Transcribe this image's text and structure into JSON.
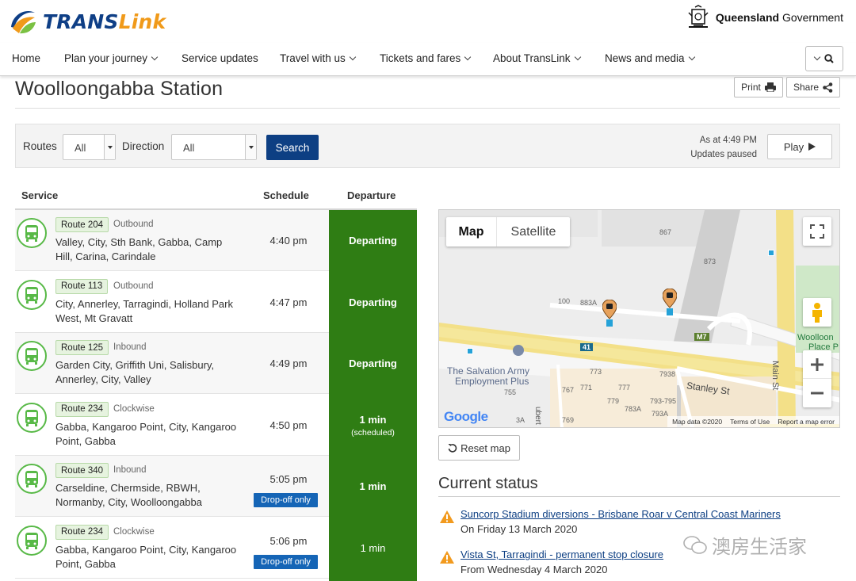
{
  "brand": {
    "name_a": "TRANS",
    "name_b": "Link",
    "gov": "Queensland",
    "gov_b": "Government",
    "blue": "#0f3f86",
    "orange": "#f09a1a"
  },
  "nav": [
    "Home",
    "Plan your journey",
    "Service updates",
    "Travel with us",
    "Tickets and fares",
    "About TransLink",
    "News and media"
  ],
  "page": {
    "title": "Woolloongabba Station",
    "print": "Print",
    "share": "Share"
  },
  "filter": {
    "routes_label": "Routes",
    "routes_value": "All",
    "direction_label": "Direction",
    "direction_value": "All",
    "search": "Search",
    "as_at": "As at 4:49 PM",
    "updates": "Updates paused",
    "play": "Play"
  },
  "table": {
    "headers": {
      "service": "Service",
      "schedule": "Schedule",
      "departure": "Departure"
    },
    "rows": [
      {
        "route": "Route 204",
        "direction": "Outbound",
        "stops": "Valley, City, Sth Bank, Gabba, Camp Hill, Carina, Carindale",
        "schedule": "4:40 pm",
        "departure": "Departing",
        "note": ""
      },
      {
        "route": "Route 113",
        "direction": "Outbound",
        "stops": "City, Annerley, Tarragindi, Holland Park West, Mt Gravatt",
        "schedule": "4:47 pm",
        "departure": "Departing",
        "note": ""
      },
      {
        "route": "Route 125",
        "direction": "Inbound",
        "stops": "Garden City, Griffith Uni, Salisbury, Annerley, City, Valley",
        "schedule": "4:49 pm",
        "departure": "Departing",
        "note": ""
      },
      {
        "route": "Route 234",
        "direction": "Clockwise",
        "stops": "Gabba, Kangaroo Point, City, Kangaroo Point, Gabba",
        "schedule": "4:50 pm",
        "departure": "1 min",
        "note": "(scheduled)"
      },
      {
        "route": "Route 340",
        "direction": "Inbound",
        "stops": "Carseldine, Chermside, RBWH, Normanby, City, Woolloongabba",
        "schedule": "5:05 pm",
        "departure": "1 min",
        "note": "",
        "dropoff": "Drop-off only"
      },
      {
        "route": "Route 234",
        "direction": "Clockwise",
        "stops": "Gabba, Kangaroo Point, City, Kangaroo Point, Gabba",
        "schedule": "5:06 pm",
        "departure": "1 min",
        "note": "",
        "dropoff": "Drop-off only"
      }
    ]
  },
  "map": {
    "tab_map": "Map",
    "tab_satellite": "Satellite",
    "labels": {
      "867": "867",
      "873": "873",
      "100": "100",
      "883a": "883A",
      "m7": "M7",
      "r41": "41",
      "wool": "Woolloon",
      "place": "Place P",
      "mainst": "Main St",
      "salv1": "The Salvation Army",
      "salv2": "Employment Plus",
      "755": "755",
      "767": "767",
      "771": "771",
      "773": "773",
      "777": "777",
      "7938": "7938",
      "779": "779",
      "783a": "783A",
      "793": "793-795",
      "793a": "793A",
      "3a": "3A",
      "769": "769",
      "stanley": "Stanley St",
      "hubert": "ubert St"
    },
    "google": "Google",
    "footer": {
      "data": "Map data ©2020",
      "terms": "Terms of Use",
      "report": "Report a map error"
    }
  },
  "reset_map": "Reset map",
  "status": {
    "title": "Current status",
    "alerts": [
      {
        "link": "Suncorp Stadium diversions - Brisbane Roar v Central Coast Mariners",
        "date": "On Friday 13 March 2020"
      },
      {
        "link": "Vista St, Tarragindi - permanent stop closure",
        "date": "From Wednesday 4 March 2020"
      }
    ]
  },
  "watermark": "澳房生活家"
}
